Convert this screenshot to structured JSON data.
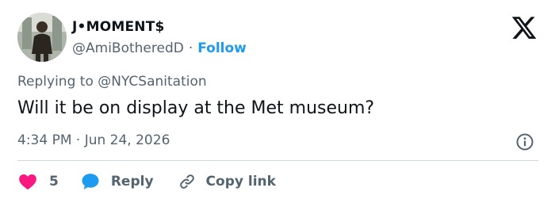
{
  "author": {
    "display_name": "J•MOMENT$",
    "handle": "@AmiBotheredD",
    "separator": "·",
    "follow_label": "Follow",
    "avatar_icon": "user-avatar-photo"
  },
  "reply_context": {
    "prefix": "Replying to",
    "mention": "@NYCSanitation"
  },
  "tweet": {
    "text": "Will it be on display at the Met museum?",
    "timestamp": "4:34 PM · Jun 24, 2026"
  },
  "actions": {
    "like_count": "5",
    "reply_label": "Reply",
    "copy_link_label": "Copy link"
  },
  "colors": {
    "accent": "#1d9bf0",
    "heart": "#f91880",
    "text_primary": "#0f1419",
    "text_secondary": "#536471",
    "divider": "#cfd9de"
  },
  "icons": {
    "brand": "x-logo-icon",
    "info": "info-icon",
    "like": "heart-icon",
    "reply": "chat-bubble-icon",
    "copy": "link-icon"
  }
}
